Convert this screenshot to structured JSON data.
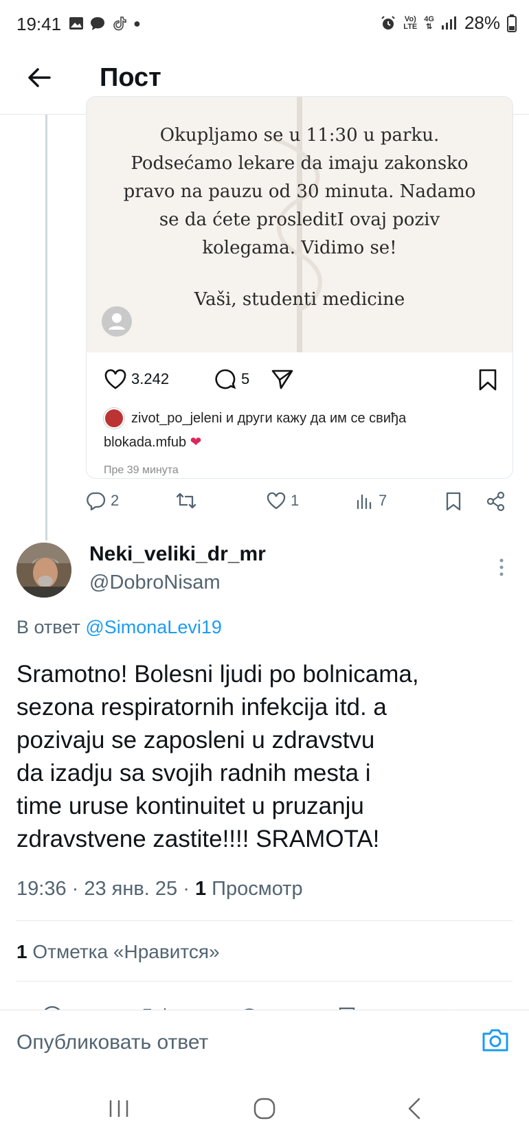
{
  "status_bar": {
    "time": "19:41",
    "battery": "28%",
    "network_top": "Vo)",
    "network_bottom": "LTE",
    "network_gen": "4G"
  },
  "header": {
    "title": "Пост"
  },
  "embedded_card": {
    "image_lines": [
      "Okupljamo se u 11:30 u parku.",
      "Podsećamo lekare da imaju zakonsko",
      "pravo na pauzu od 30 minuta.  Nadamo",
      "se da ćete prosleditI ovaj poziv",
      "kolegama. Vidimo se!"
    ],
    "signature": "Vaši, studenti medicine",
    "like_count": "3.242",
    "comment_count": "5",
    "liked_by": "zivot_po_jeleni и други кажу да им се свиђа",
    "caption_user": "blokada.mfub",
    "time_ago": "Пре 39 минута"
  },
  "parent_actions": {
    "replies": "2",
    "retweets": "",
    "likes": "1",
    "views": "7"
  },
  "tweet": {
    "display_name": "Neki_veliki_dr_mr",
    "handle": "@DobroNisam",
    "reply_prefix": "В ответ",
    "reply_to": "@SimonaLevi19",
    "body_lines": [
      "Sramotno! Bolesni ljudi po bolnicama,",
      "sezona respiratornih infekcija itd. a",
      "pozivaju se zaposleni u zdravstvu",
      "da izadju sa svojih radnih mesta i",
      "time uruse kontinuitet u pruzanju",
      "zdravstvene zastite!!!! SRAMOTA!"
    ],
    "time": "19:36",
    "date": "23 янв. 25",
    "views_count": "1",
    "views_label": "Просмотр",
    "likes_count": "1",
    "likes_label": "Отметка «Нравится»"
  },
  "composer": {
    "placeholder": "Опубликовать ответ"
  },
  "colors": {
    "accent": "#1d9bf0",
    "heart": "#e0245e"
  },
  "icons": [
    "back-arrow-icon",
    "heart-icon",
    "comment-icon",
    "send-icon",
    "bookmark-icon",
    "reply-icon",
    "retweet-icon",
    "views-icon",
    "share-icon",
    "more-icon",
    "camera-icon"
  ]
}
